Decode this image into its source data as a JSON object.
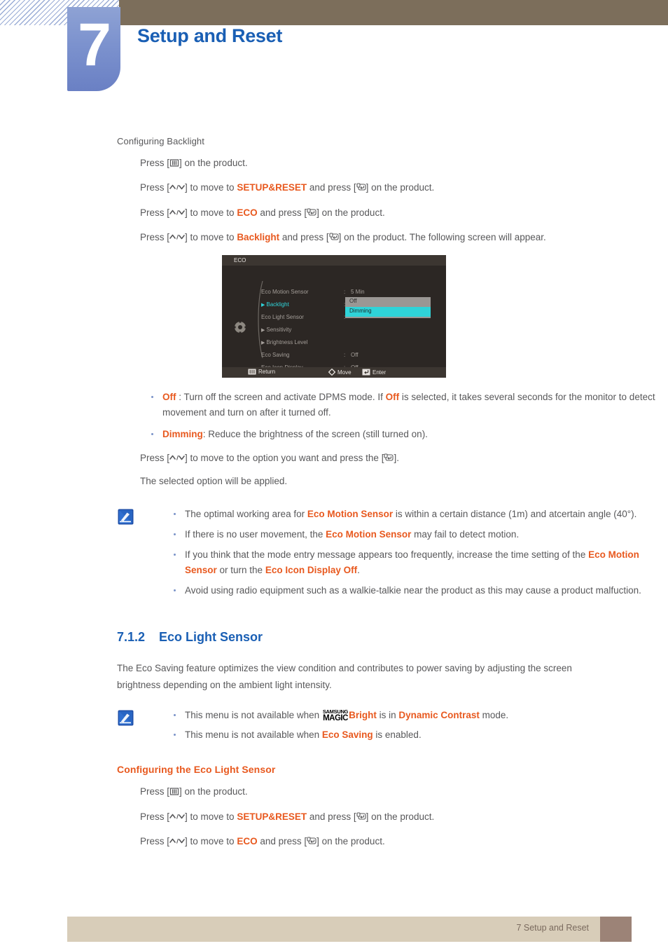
{
  "header": {
    "chapter_number": "7",
    "chapter_title": "Setup and Reset"
  },
  "section_backlight": {
    "heading": "Configuring Backlight",
    "steps": [
      {
        "pre": "Press [",
        "key": "menu-key",
        "post": "] on the product."
      },
      {
        "pre": "Press [",
        "key": "updown-key",
        "mid": "] to move to ",
        "target": "SETUP&RESET",
        "mid2": " and press [",
        "key2": "enter-key",
        "post": "] on the product."
      },
      {
        "pre": "Press [",
        "key": "updown-key",
        "mid": "] to move to ",
        "target": "ECO",
        "mid2": " and press [",
        "key2": "enter-key",
        "post": "] on the product."
      },
      {
        "pre": "Press [",
        "key": "updown-key",
        "mid": "] to move to ",
        "target": "Backlight",
        "mid2": " and press [",
        "key2": "enter-key",
        "post": "] on the product. The following screen will appear."
      }
    ]
  },
  "osd": {
    "title": "ECO",
    "rows": [
      {
        "label": "Eco Motion Sensor",
        "arrow": false,
        "colon": ":",
        "value": "5 Min",
        "selected": false
      },
      {
        "label": "Backlight",
        "arrow": true,
        "colon": ":",
        "value": "",
        "selected": true
      },
      {
        "label": "Eco Light Sensor",
        "arrow": false,
        "colon": ":",
        "value": "",
        "selected": false
      },
      {
        "label": "Sensitivity",
        "arrow": true,
        "colon": "",
        "value": "",
        "selected": false
      },
      {
        "label": "Brightness Level",
        "arrow": true,
        "colon": "",
        "value": "",
        "selected": false
      },
      {
        "label": "Eco Saving",
        "arrow": false,
        "colon": ":",
        "value": "Off",
        "selected": false
      },
      {
        "label": "Eco Icon Display",
        "arrow": false,
        "colon": ":",
        "value": "Off",
        "selected": false
      }
    ],
    "popup_options": [
      {
        "label": "Off",
        "active": false
      },
      {
        "label": "Dimming",
        "active": true
      }
    ],
    "footer": [
      {
        "icon": "menu-key",
        "label": "Return"
      },
      {
        "icon": "move-diamond",
        "label": "Move"
      },
      {
        "icon": "enter-key",
        "label": "Enter"
      }
    ],
    "colors": {
      "highlight": "#2fd3d8",
      "background": "#2c2724",
      "bar": "#3c3631"
    }
  },
  "option_bullets": [
    {
      "term": "Off",
      "rest": " : Turn off the screen and activate DPMS mode. If ",
      "term2": "Off",
      "rest2": " is selected, it takes several seconds for the monitor to detect movement and turn on after it turned off."
    },
    {
      "term": "Dimming",
      "rest": ": Reduce the brightness of the screen (still turned on).",
      "term2": "",
      "rest2": ""
    }
  ],
  "after_option_steps": [
    {
      "pre": "Press [",
      "key": "updown-key",
      "post": "] to move to the option you want and press the [",
      "key2": "enter-key",
      "post2": "]."
    },
    {
      "plain": "The selected option will be applied."
    }
  ],
  "note_1": {
    "icon": "note-pencil-icon",
    "items": [
      {
        "a": "The optimal working area for ",
        "b": "Eco Motion Sensor",
        "c": " is within a certain distance (1m) and atcertain angle (40°)."
      },
      {
        "a": "If there is no user movement, the ",
        "b": "Eco Motion Sensor",
        "c": " may fail to detect motion."
      },
      {
        "a": "If you think that the mode entry message appears too frequently, increase the time setting of the ",
        "b": "Eco Motion Sensor",
        "c": " or turn the ",
        "d": "Eco Icon Display Off",
        "e": "."
      },
      {
        "a": "Avoid using radio equipment such as a walkie-talkie near the product as this may cause a product malfuction.",
        "b": "",
        "c": ""
      }
    ]
  },
  "section_eco_light_sensor": {
    "number": "7.1.2",
    "title": "Eco Light Sensor",
    "paragraph": "The Eco Saving feature optimizes the view condition and contributes to power saving by adjusting the screen brightness depending on the ambient light intensity.",
    "note": {
      "icon": "note-pencil-icon",
      "items": [
        {
          "a": "This menu is not available when ",
          "logo_line1": "SAMSUNG",
          "logo_line2": "MAGIC",
          "b": "Bright",
          "c": " is in ",
          "d": "Dynamic Contrast",
          "e": " mode."
        },
        {
          "a": "This menu is not available when ",
          "b": "Eco Saving",
          "c": " is enabled."
        }
      ]
    },
    "sub_heading": "Configuring the Eco Light Sensor",
    "steps": [
      {
        "pre": "Press [",
        "key": "menu-key",
        "post": "] on the product."
      },
      {
        "pre": "Press [",
        "key": "updown-key",
        "mid": "] to move to ",
        "target": "SETUP&RESET",
        "mid2": " and press [",
        "key2": "enter-key",
        "post": "] on the product."
      },
      {
        "pre": "Press [",
        "key": "updown-key",
        "mid": "] to move to ",
        "target": "ECO",
        "mid2": " and press [",
        "key2": "enter-key",
        "post": "] on the product."
      }
    ]
  },
  "footer": {
    "text": "7 Setup and Reset"
  },
  "theme": {
    "accent_orange": "#e8591f",
    "accent_blue": "#1a5fb4",
    "header_brown": "#7c6e5b",
    "footer_tan": "#d8cdb9",
    "footer_block": "#9c8377"
  }
}
